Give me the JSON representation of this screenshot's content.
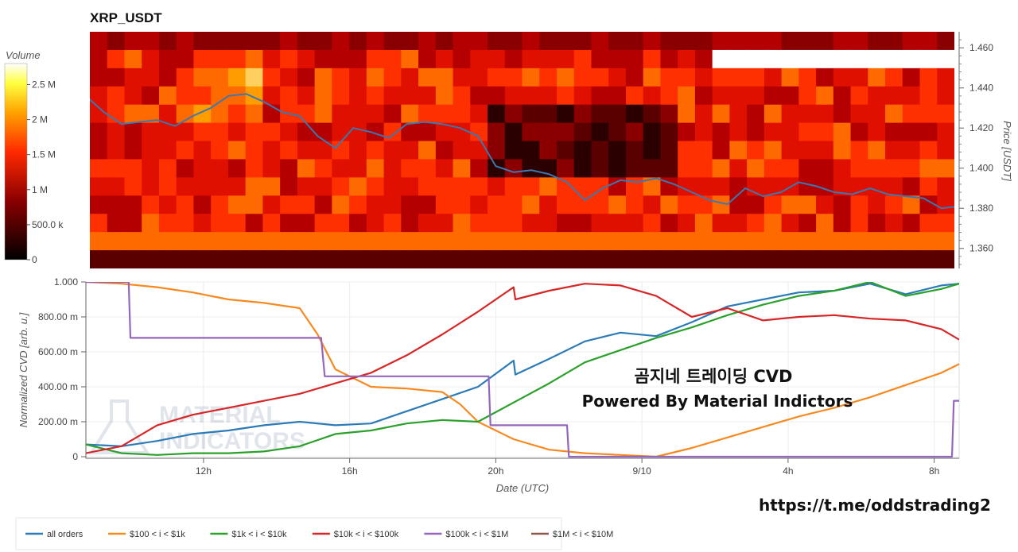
{
  "chart_data": [
    {
      "type": "heatmap",
      "title": "XRP_USDT",
      "ylabel": "Price [USDT]",
      "yticks": [
        "1.460",
        "1.440",
        "1.420",
        "1.400",
        "1.380",
        "1.360"
      ],
      "ylim": [
        1.35,
        1.468
      ],
      "colorbar": {
        "title": "Volume",
        "ticks": [
          "2.5 M",
          "2 M",
          "1.5 M",
          "1 M",
          "500.0 k",
          "0"
        ],
        "range": [
          0,
          2800000
        ]
      },
      "price_line": {
        "color": "#3a78b0",
        "x": [
          0,
          0.5,
          1,
          1.5,
          2,
          2.5,
          3,
          3.5,
          4,
          4.5,
          5,
          5.5,
          6,
          6.5,
          7,
          7.5,
          8,
          8.5,
          9,
          9.5,
          10,
          10.5,
          11,
          11.5,
          12,
          12.5,
          13,
          13.5,
          14,
          14.5,
          15,
          15.5,
          16,
          16.5,
          17,
          17.5,
          18,
          18.5,
          19,
          19.5,
          20,
          20.5,
          21,
          21.5,
          22,
          22.5,
          23,
          23.5,
          24,
          24.5
        ],
        "y": [
          1.436,
          1.428,
          1.422,
          1.423,
          1.424,
          1.421,
          1.426,
          1.43,
          1.436,
          1.437,
          1.433,
          1.428,
          1.426,
          1.416,
          1.41,
          1.42,
          1.418,
          1.415,
          1.422,
          1.423,
          1.422,
          1.42,
          1.416,
          1.401,
          1.398,
          1.399,
          1.397,
          1.393,
          1.384,
          1.39,
          1.394,
          1.393,
          1.395,
          1.392,
          1.388,
          1.384,
          1.382,
          1.39,
          1.386,
          1.388,
          1.393,
          1.391,
          1.388,
          1.387,
          1.39,
          1.387,
          1.386,
          1.385,
          1.38,
          1.381
        ]
      }
    },
    {
      "type": "line",
      "ylabel": "Normalized CVD [arb. u.]",
      "xlabel": "Date (UTC)",
      "xticks": [
        "12h",
        "16h",
        "20h",
        "9/10",
        "4h",
        "8h"
      ],
      "yticks": [
        "1.000",
        "800.00 m",
        "600.00 m",
        "400.00 m",
        "200.00 m",
        "0"
      ],
      "ylim": [
        0,
        1
      ],
      "series": [
        {
          "name": "all orders",
          "color": "#2c7bb6",
          "x": [
            0,
            1,
            2,
            3,
            4,
            5,
            6,
            7,
            8,
            9,
            10,
            11,
            12,
            12.05,
            13,
            14,
            15,
            16,
            17,
            18,
            19,
            20,
            21,
            22,
            23,
            24,
            24.5
          ],
          "y": [
            0.07,
            0.06,
            0.09,
            0.13,
            0.15,
            0.18,
            0.2,
            0.18,
            0.19,
            0.26,
            0.33,
            0.4,
            0.55,
            0.47,
            0.56,
            0.66,
            0.71,
            0.69,
            0.77,
            0.86,
            0.9,
            0.94,
            0.95,
            0.99,
            0.93,
            0.98,
            0.99
          ]
        },
        {
          "name": "$100 < i < $1k",
          "color": "#f6891f",
          "x": [
            0,
            1,
            2,
            3,
            4,
            5,
            6,
            6.5,
            7,
            7.5,
            8,
            9,
            10,
            10.5,
            11,
            12,
            13,
            14,
            15,
            16,
            17,
            18,
            19,
            20,
            21,
            22,
            23,
            24,
            24.5
          ],
          "y": [
            1.0,
            0.99,
            0.97,
            0.94,
            0.9,
            0.88,
            0.85,
            0.7,
            0.5,
            0.45,
            0.4,
            0.39,
            0.37,
            0.3,
            0.2,
            0.1,
            0.04,
            0.02,
            0.01,
            0.0,
            0.05,
            0.11,
            0.17,
            0.23,
            0.28,
            0.34,
            0.41,
            0.48,
            0.53
          ]
        },
        {
          "name": "$1k < i < $10k",
          "color": "#2ca02c",
          "x": [
            0,
            1,
            2,
            3,
            4,
            5,
            6,
            7,
            8,
            9,
            10,
            11,
            12,
            13,
            14,
            15,
            16,
            17,
            18,
            19,
            20,
            21,
            22,
            23,
            24,
            24.5
          ],
          "y": [
            0.07,
            0.02,
            0.01,
            0.02,
            0.02,
            0.03,
            0.06,
            0.13,
            0.15,
            0.19,
            0.21,
            0.2,
            0.31,
            0.42,
            0.54,
            0.61,
            0.68,
            0.74,
            0.81,
            0.87,
            0.92,
            0.95,
            1.0,
            0.92,
            0.96,
            0.99
          ]
        },
        {
          "name": "$10k < i < $100k",
          "color": "#d62728",
          "x": [
            0,
            1,
            2,
            3,
            4,
            5,
            6,
            7,
            8,
            9,
            10,
            11,
            12,
            12.05,
            13,
            14,
            15,
            16,
            17,
            18,
            19,
            20,
            21,
            22,
            23,
            24,
            24.5
          ],
          "y": [
            0.02,
            0.06,
            0.18,
            0.24,
            0.28,
            0.32,
            0.36,
            0.42,
            0.48,
            0.58,
            0.7,
            0.83,
            0.97,
            0.9,
            0.95,
            0.99,
            0.98,
            0.92,
            0.8,
            0.85,
            0.78,
            0.8,
            0.81,
            0.79,
            0.78,
            0.73,
            0.67
          ]
        },
        {
          "name": "$100k < i < $1M",
          "color": "#9467bd",
          "x": [
            0,
            1.2,
            1.25,
            6.6,
            6.7,
            11.3,
            11.35,
            13.5,
            13.55,
            24.3,
            24.35,
            24.5
          ],
          "y": [
            1.0,
            1.0,
            0.68,
            0.68,
            0.46,
            0.46,
            0.18,
            0.18,
            0.0,
            0.0,
            0.32,
            0.32
          ]
        },
        {
          "name": "$1M < i < $10M",
          "color": "#8c564b",
          "x": [],
          "y": []
        }
      ]
    }
  ],
  "overlay": {
    "line1": "곰지네 트레이딩 CVD",
    "line2": "Powered By Material Indictors",
    "link": "https://t.me/oddstrading2",
    "watermark": [
      "MATERIAL",
      "INDICATORS"
    ]
  }
}
